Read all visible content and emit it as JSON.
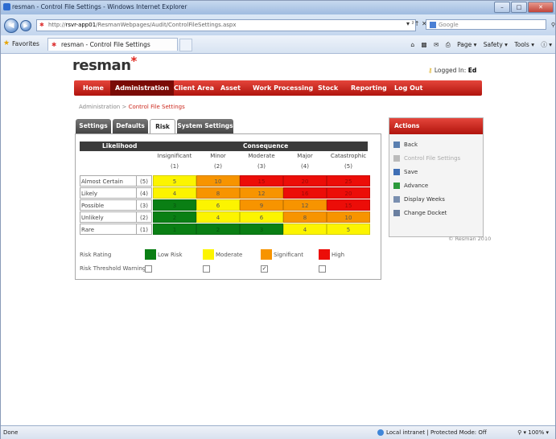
{
  "browser": {
    "window_title": "resman - Control File Settings - Windows Internet Explorer",
    "url_prefix": "http://",
    "url_domain": "rsvr-app01",
    "url_path": "/ResmanWebpages/Audit/ControlFileSettings.aspx",
    "url_controls": "▾ ²↑ ✕",
    "search_placeholder": "Google",
    "favorites_label": "Favorites",
    "tab_title": "resman - Control File Settings",
    "command_bar": [
      "Page ▾",
      "Safety ▾",
      "Tools ▾",
      "ⓘ ▾"
    ]
  },
  "app": {
    "logo": "resman",
    "logo_mark": "*",
    "logged_in_label": "Logged In:",
    "logged_in_user": "Ed"
  },
  "nav": {
    "items": [
      "Home",
      "Administration",
      "Client Area",
      "Asset",
      "Work Processing",
      "Stock",
      "Reporting",
      "Log Out"
    ],
    "active": "Administration"
  },
  "breadcrumb": {
    "parent": "Administration",
    "separator": " > ",
    "current": "Control File Settings"
  },
  "tabs": [
    "Settings",
    "Defaults",
    "Risk",
    "System Settings"
  ],
  "selected_tab": "Risk",
  "matrix": {
    "likelihood_title": "Likelihood",
    "consequence_title": "Consequence",
    "consequences": [
      {
        "label": "Insignificant",
        "num": "(1)"
      },
      {
        "label": "Minor",
        "num": "(2)"
      },
      {
        "label": "Moderate",
        "num": "(3)"
      },
      {
        "label": "Major",
        "num": "(4)"
      },
      {
        "label": "Catastrophic",
        "num": "(5)"
      }
    ],
    "rows": [
      {
        "label": "Almost Certain",
        "num": "(5)",
        "values": [
          "5",
          "10",
          "15",
          "20",
          "25"
        ]
      },
      {
        "label": "Likely",
        "num": "(4)",
        "values": [
          "4",
          "8",
          "12",
          "16",
          "20"
        ]
      },
      {
        "label": "Possible",
        "num": "(3)",
        "values": [
          "3",
          "6",
          "9",
          "12",
          "15"
        ]
      },
      {
        "label": "Unlikely",
        "num": "(2)",
        "values": [
          "2",
          "4",
          "6",
          "8",
          "10"
        ]
      },
      {
        "label": "Rare",
        "num": "(1)",
        "values": [
          "1",
          "2",
          "3",
          "4",
          "5"
        ]
      }
    ],
    "colors": {
      "low": "#0a7f14",
      "moderate": "#fcf400",
      "significant": "#f79400",
      "high": "#ec0d08"
    }
  },
  "legend": {
    "risk_rating_label": "Risk Rating",
    "threshold_label": "Risk Threshold Warning",
    "levels": [
      "Low Risk",
      "Moderate",
      "Significant",
      "High"
    ],
    "threshold_checked": [
      false,
      false,
      true,
      false
    ]
  },
  "actions": {
    "title": "Actions",
    "items": [
      {
        "label": "Back",
        "disabled": false
      },
      {
        "label": "Control File Settings",
        "disabled": true
      },
      {
        "label": "Save",
        "disabled": false
      },
      {
        "label": "Advance",
        "disabled": false
      },
      {
        "label": "Display Weeks",
        "disabled": false
      },
      {
        "label": "Change Docket",
        "disabled": false
      }
    ]
  },
  "copyright": "© Resman 2010",
  "status": {
    "done": "Done",
    "zone": "Local intranet | Protected Mode: Off",
    "zoom": "100%"
  }
}
